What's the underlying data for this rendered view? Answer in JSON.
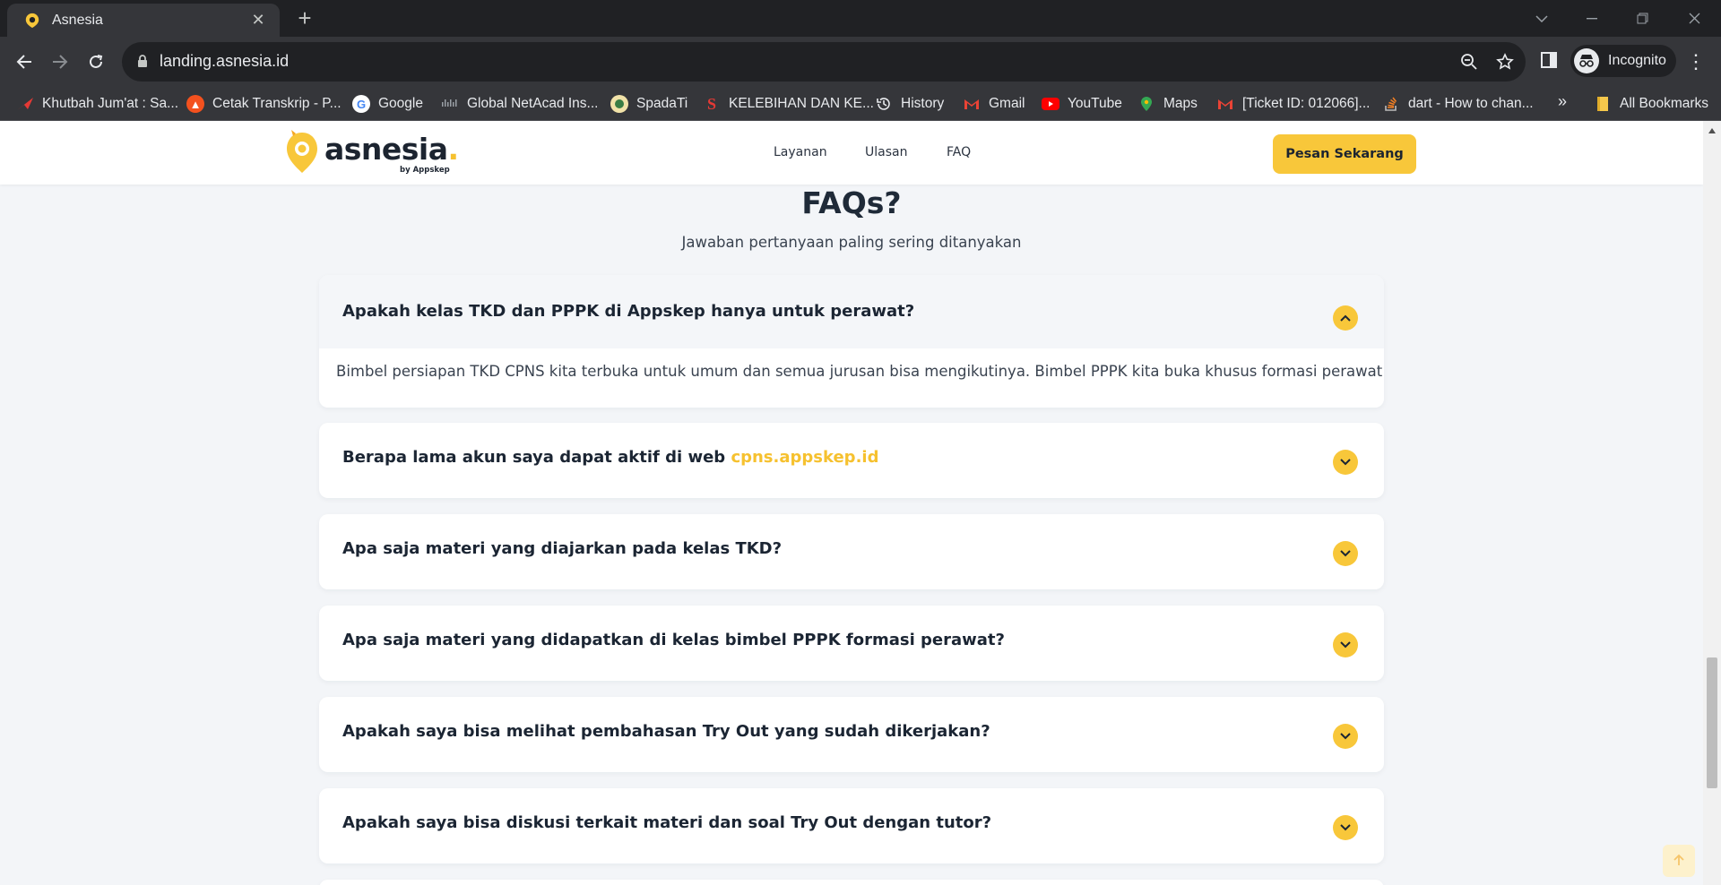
{
  "browser": {
    "tab_title": "Asnesia",
    "url": "landing.asnesia.id",
    "profile_label": "Incognito",
    "bookmarks": [
      {
        "label": "Khutbah Jum'at : Sa...",
        "icon": "red-wing-icon",
        "color": "#e53935"
      },
      {
        "label": "Cetak Transkrip - P...",
        "icon": "graduation-cap-icon",
        "color": "#f4511e"
      },
      {
        "label": "Google",
        "icon": "google-icon",
        "color": "#4285f4"
      },
      {
        "label": "Global NetAcad Ins...",
        "icon": "cisco-icon",
        "color": "#9aa0a6"
      },
      {
        "label": "SpadaTi",
        "icon": "spadati-emblem-icon",
        "color": "#d4a017"
      },
      {
        "label": "KELEBIHAN DAN KE...",
        "icon": "letter-s-icon",
        "color": "#e53935"
      },
      {
        "label": "History",
        "icon": "history-icon",
        "color": "#e8eaed"
      },
      {
        "label": "Gmail",
        "icon": "gmail-icon",
        "color": "#ea4335"
      },
      {
        "label": "YouTube",
        "icon": "youtube-icon",
        "color": "#ff0000"
      },
      {
        "label": "Maps",
        "icon": "maps-pin-icon",
        "color": "#34a853"
      },
      {
        "label": "[Ticket ID: 012066]...",
        "icon": "gmail-icon",
        "color": "#ea4335"
      },
      {
        "label": "dart - How to chan...",
        "icon": "stackoverflow-icon",
        "color": "#f48024"
      }
    ],
    "bookmarks_overflow": "»",
    "all_bookmarks_label": "All Bookmarks"
  },
  "site": {
    "brand": "asnesia",
    "brand_dot": ".",
    "brand_by": "by Appskep",
    "nav": [
      "Layanan",
      "Ulasan",
      "FAQ"
    ],
    "cta_label": "Pesan Sekarang",
    "accent_color": "#f8c73a",
    "text_color": "#1b2533"
  },
  "faq": {
    "title": "FAQs?",
    "subtitle": "Jawaban pertanyaan paling sering ditanyakan",
    "items": [
      {
        "question": "Apakah kelas TKD dan PPPK di Appskep hanya untuk perawat?",
        "open": true,
        "answer": "Bimbel persiapan TKD CPNS kita terbuka untuk umum dan semua jurusan bisa mengikutinya. Bimbel PPPK kita buka khusus formasi perawat"
      },
      {
        "question": "Berapa lama akun saya dapat aktif di web ",
        "question_link": "cpns.appskep.id",
        "open": false
      },
      {
        "question": "Apa saja materi yang diajarkan pada kelas TKD?",
        "open": false
      },
      {
        "question": "Apa saja materi yang didapatkan di kelas bimbel PPPK formasi perawat?",
        "open": false
      },
      {
        "question": "Apakah saya bisa melihat pembahasan Try Out yang sudah dikerjakan?",
        "open": false
      },
      {
        "question": "Apakah saya bisa diskusi terkait materi dan soal Try Out dengan tutor?",
        "open": false
      }
    ]
  }
}
